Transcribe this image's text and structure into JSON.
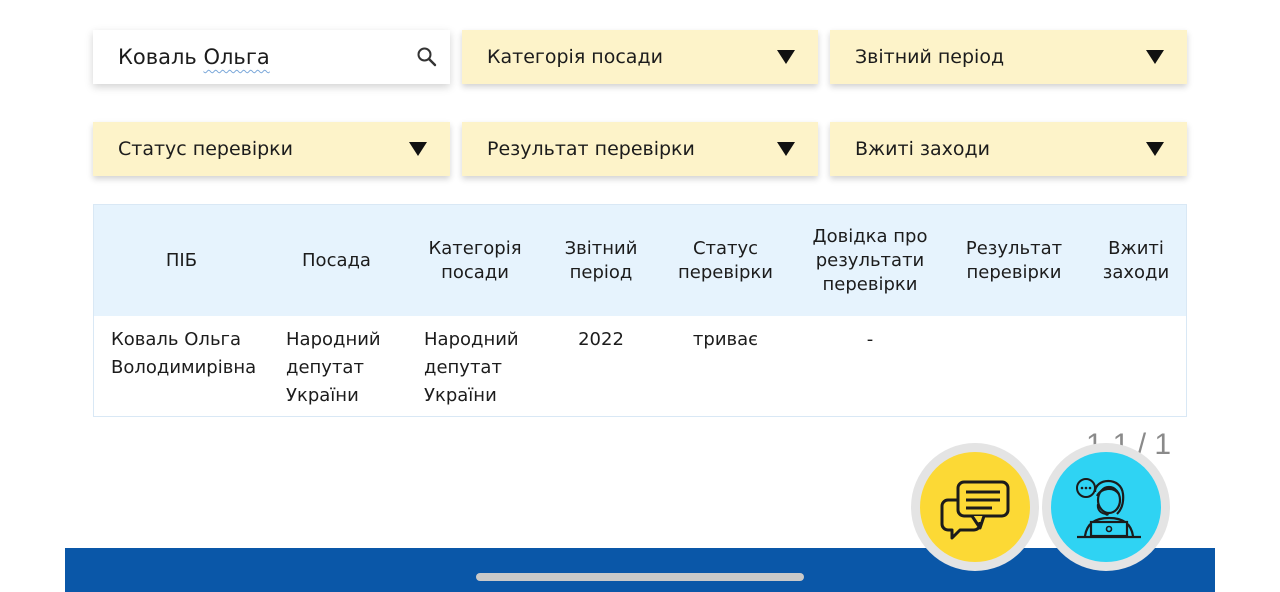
{
  "search": {
    "value_prefix": "Коваль ",
    "value_underlined": "Ольга"
  },
  "filters": {
    "category": "Категорія посади",
    "period": "Звітний період",
    "status": "Статус перевірки",
    "result": "Результат перевірки",
    "measures": "Вжиті заходи"
  },
  "table": {
    "headers": {
      "name": "ПІБ",
      "position": "Посада",
      "category": "Категорія посади",
      "period": "Звітний період",
      "status": "Статус перевірки",
      "certificate": "Довідка про результати перевірки",
      "result": "Результат перевірки",
      "measures": "Вжиті заходи"
    },
    "rows": [
      {
        "name": "Коваль Ольга Володимирівна",
        "position": "Народний депутат України",
        "category": "Народний депутат України",
        "period": "2022",
        "status": "триває",
        "certificate": "-",
        "result": "",
        "measures": ""
      }
    ]
  },
  "pagination": {
    "text": "1-1 / 1"
  },
  "colors": {
    "filter_bg": "#fdf3c9",
    "header_bg": "#e6f3fd",
    "chat_button": "#fcd935",
    "support_button": "#2fd3f3",
    "bottom_bar": "#0a57a8"
  },
  "icons": {
    "search": "search-icon",
    "dropdown": "triangle-down-icon",
    "chat": "chat-bubbles-icon",
    "support": "support-operator-icon"
  }
}
